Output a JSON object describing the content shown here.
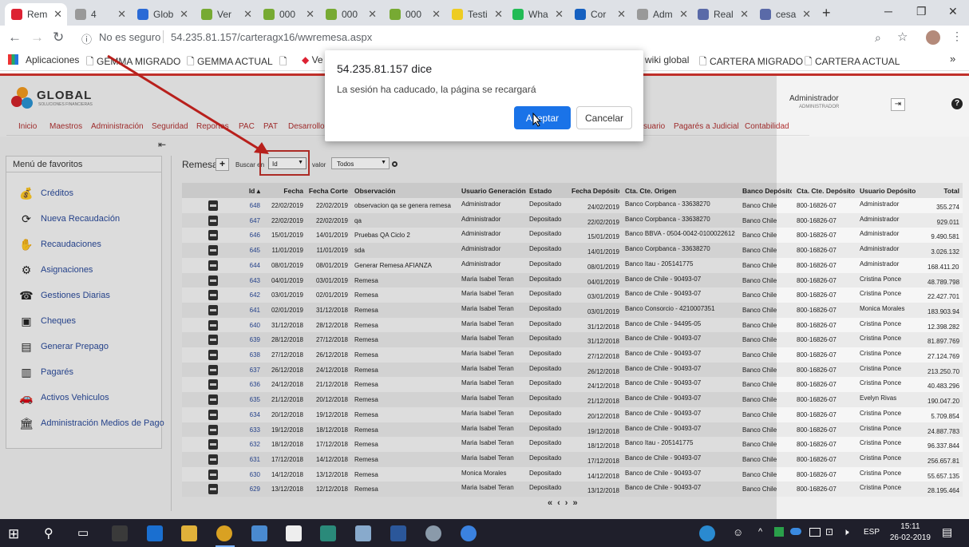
{
  "tabs": [
    {
      "label": "Rem",
      "color": "#d23"
    },
    {
      "label": "4",
      "color": "#999"
    },
    {
      "label": "Glob",
      "color": "#2a6ad6"
    },
    {
      "label": "Ver",
      "color": "#7a3"
    },
    {
      "label": "000",
      "color": "#7a3"
    },
    {
      "label": "000",
      "color": "#7a3"
    },
    {
      "label": "000",
      "color": "#7a3"
    },
    {
      "label": "Testi",
      "color": "#ec2"
    },
    {
      "label": "Wha",
      "color": "#2b5"
    },
    {
      "label": "Cor",
      "color": "#1560c0"
    },
    {
      "label": "Adm",
      "color": "#999"
    },
    {
      "label": "Real",
      "color": "#5a6aa8"
    },
    {
      "label": "cesa",
      "color": "#5a6aa8"
    }
  ],
  "browser": {
    "security_label": "No es seguro",
    "url": "54.235.81.157/carteragx16/wwremesa.aspx"
  },
  "bookmarks": [
    "Aplicaciones",
    "GEMMA MIGRADO",
    "GEMMA ACTUAL",
    "",
    "Ve",
    "wiki global",
    "CARTERA MIGRADO",
    "CARTERA ACTUAL"
  ],
  "app": {
    "logo_text": "GLOBAL",
    "logo_sub": "SOLUCIONES FINANCIERAS",
    "user_name": "Administrador",
    "user_role": "ADMINISTRADOR",
    "menu": [
      "Inicio",
      "Maestros",
      "Administración",
      "Seguridad",
      "Reportes",
      "PAC",
      "PAT",
      "Desarrollo",
      "suario",
      "Pagarés a Judicial",
      "Contabilidad"
    ]
  },
  "favorites": {
    "title": "Menú de favoritos",
    "items": [
      {
        "label": "Créditos",
        "icon": "money-bag-icon"
      },
      {
        "label": "Nueva Recaudación",
        "icon": "refresh-money-icon"
      },
      {
        "label": "Recaudaciones",
        "icon": "hand-money-icon"
      },
      {
        "label": "Asignaciones",
        "icon": "gear-icon"
      },
      {
        "label": "Gestiones Diarias",
        "icon": "phone-icon"
      },
      {
        "label": "Cheques",
        "icon": "cheque-icon"
      },
      {
        "label": "Generar Prepago",
        "icon": "wallet-icon"
      },
      {
        "label": "Pagarés",
        "icon": "document-money-icon"
      },
      {
        "label": "Activos Vehiculos",
        "icon": "car-icon"
      },
      {
        "label": "Administración Medios de Pago",
        "icon": "bank-icon"
      }
    ]
  },
  "remesa": {
    "title": "Remesa",
    "search_label": "Buscar en",
    "search_value": "Id",
    "value_label": "valor",
    "value_value": "Todos"
  },
  "table": {
    "headers": [
      "Id ▴",
      "Fecha",
      "Fecha Corte",
      "Observación",
      "Usuario Generación",
      "Estado",
      "Fecha Depósito",
      "Cta. Cte. Origen",
      "Banco Depósito",
      "Cta. Cte. Depósito",
      "Usuario Depósito",
      "Total"
    ],
    "rows": [
      [
        "648",
        "22/02/2019",
        "22/02/2019",
        "observacion qa se genera remesa",
        "Administrador",
        "Depositado",
        "24/02/2019",
        "Banco Corpbanca - 33638270",
        "Banco Chile",
        "800-16826-07",
        "Administrador",
        "355.274"
      ],
      [
        "647",
        "22/02/2019",
        "22/02/2019",
        "qa",
        "Administrador",
        "Depositado",
        "22/02/2019",
        "Banco Corpbanca - 33638270",
        "Banco Chile",
        "800-16826-07",
        "Administrador",
        "929.011"
      ],
      [
        "646",
        "15/01/2019",
        "14/01/2019",
        "Pruebas QA Ciclo 2",
        "Administrador",
        "Depositado",
        "15/01/2019",
        "Banco BBVA - 0504-0042-0100022612",
        "Banco Chile",
        "800-16826-07",
        "Administrador",
        "9.490.581"
      ],
      [
        "645",
        "11/01/2019",
        "11/01/2019",
        "sda",
        "Administrador",
        "Depositado",
        "14/01/2019",
        "Banco Corpbanca - 33638270",
        "Banco Chile",
        "800-16826-07",
        "Administrador",
        "3.026.132"
      ],
      [
        "644",
        "08/01/2019",
        "08/01/2019",
        "Generar Remesa AFIANZA",
        "Administrador",
        "Depositado",
        "08/01/2019",
        "Banco Itau - 205141775",
        "Banco Chile",
        "800-16826-07",
        "Administrador",
        "168.411.205"
      ],
      [
        "643",
        "04/01/2019",
        "03/01/2019",
        "Remesa",
        "Maria Isabel Teran",
        "Depositado",
        "04/01/2019",
        "Banco de Chile - 90493-07",
        "Banco Chile",
        "800-16826-07",
        "Cristina Ponce",
        "48.789.798"
      ],
      [
        "642",
        "03/01/2019",
        "02/01/2019",
        "Remesa",
        "Maria Isabel Teran",
        "Depositado",
        "03/01/2019",
        "Banco de Chile - 90493-07",
        "Banco Chile",
        "800-16826-07",
        "Cristina Ponce",
        "22.427.701"
      ],
      [
        "641",
        "02/01/2019",
        "31/12/2018",
        "Remesa",
        "Maria Isabel Teran",
        "Depositado",
        "03/01/2019",
        "Banco Consorcio - 4210007351",
        "Banco Chile",
        "800-16826-07",
        "Monica Morales",
        "183.903.949"
      ],
      [
        "640",
        "31/12/2018",
        "28/12/2018",
        "Remesa",
        "Maria Isabel Teran",
        "Depositado",
        "31/12/2018",
        "Banco de Chile - 94495-05",
        "Banco Chile",
        "800-16826-07",
        "Cristina Ponce",
        "12.398.282"
      ],
      [
        "639",
        "28/12/2018",
        "27/12/2018",
        "Remesa",
        "Maria Isabel Teran",
        "Depositado",
        "31/12/2018",
        "Banco de Chile - 90493-07",
        "Banco Chile",
        "800-16826-07",
        "Cristina Ponce",
        "81.897.769"
      ],
      [
        "638",
        "27/12/2018",
        "26/12/2018",
        "Remesa",
        "Maria Isabel Teran",
        "Depositado",
        "27/12/2018",
        "Banco de Chile - 90493-07",
        "Banco Chile",
        "800-16826-07",
        "Cristina Ponce",
        "27.124.769"
      ],
      [
        "637",
        "26/12/2018",
        "24/12/2018",
        "Remesa",
        "Maria Isabel Teran",
        "Depositado",
        "26/12/2018",
        "Banco de Chile - 90493-07",
        "Banco Chile",
        "800-16826-07",
        "Cristina Ponce",
        "213.250.707"
      ],
      [
        "636",
        "24/12/2018",
        "21/12/2018",
        "Remesa",
        "Maria Isabel Teran",
        "Depositado",
        "24/12/2018",
        "Banco de Chile - 90493-07",
        "Banco Chile",
        "800-16826-07",
        "Cristina Ponce",
        "40.483.296"
      ],
      [
        "635",
        "21/12/2018",
        "20/12/2018",
        "Remesa",
        "Maria Isabel Teran",
        "Depositado",
        "21/12/2018",
        "Banco de Chile - 90493-07",
        "Banco Chile",
        "800-16826-07",
        "Evelyn Rivas",
        "190.047.209"
      ],
      [
        "634",
        "20/12/2018",
        "19/12/2018",
        "Remesa",
        "Maria Isabel Teran",
        "Depositado",
        "20/12/2018",
        "Banco de Chile - 90493-07",
        "Banco Chile",
        "800-16826-07",
        "Cristina Ponce",
        "5.709.854"
      ],
      [
        "633",
        "19/12/2018",
        "18/12/2018",
        "Remesa",
        "Maria Isabel Teran",
        "Depositado",
        "19/12/2018",
        "Banco de Chile - 90493-07",
        "Banco Chile",
        "800-16826-07",
        "Cristina Ponce",
        "24.887.783"
      ],
      [
        "632",
        "18/12/2018",
        "17/12/2018",
        "Remesa",
        "Maria Isabel Teran",
        "Depositado",
        "18/12/2018",
        "Banco Itau - 205141775",
        "Banco Chile",
        "800-16826-07",
        "Cristina Ponce",
        "96.337.844"
      ],
      [
        "631",
        "17/12/2018",
        "14/12/2018",
        "Remesa",
        "Maria Isabel Teran",
        "Depositado",
        "17/12/2018",
        "Banco de Chile - 90493-07",
        "Banco Chile",
        "800-16826-07",
        "Cristina Ponce",
        "256.657.818"
      ],
      [
        "630",
        "14/12/2018",
        "13/12/2018",
        "Remesa",
        "Monica Morales",
        "Depositado",
        "14/12/2018",
        "Banco de Chile - 90493-07",
        "Banco Chile",
        "800-16826-07",
        "Cristina Ponce",
        "55.657.135"
      ],
      [
        "629",
        "13/12/2018",
        "12/12/2018",
        "Remesa",
        "Maria Isabel Teran",
        "Depositado",
        "13/12/2018",
        "Banco de Chile - 90493-07",
        "Banco Chile",
        "800-16826-07",
        "Cristina Ponce",
        "28.195.464"
      ]
    ]
  },
  "pager": {
    "first": "«",
    "prev": "‹",
    "next": "›",
    "last": "»"
  },
  "dialog": {
    "title": "54.235.81.157 dice",
    "message": "La sesión ha caducado, la página se recargará",
    "ok_label": "Aceptar",
    "cancel_label": "Cancelar"
  },
  "taskbar": {
    "time": "15:11",
    "date": "26-02-2019",
    "lang": "ESP"
  }
}
